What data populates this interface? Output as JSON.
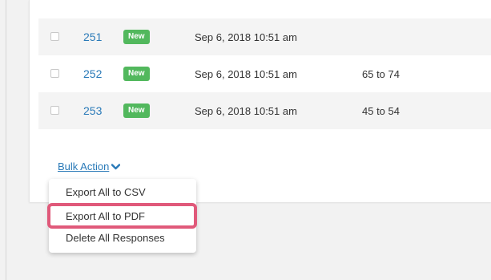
{
  "responses": [
    {
      "id": "251",
      "badge": "New",
      "date": "Sep 6, 2018 10:51 am",
      "age": ""
    },
    {
      "id": "252",
      "badge": "New",
      "date": "Sep 6, 2018 10:51 am",
      "age": "65 to 74"
    },
    {
      "id": "253",
      "badge": "New",
      "date": "Sep 6, 2018 10:51 am",
      "age": "45 to 54"
    }
  ],
  "bulk_action": {
    "label": "Bulk Action",
    "icon": "chevron-down-icon"
  },
  "menu": {
    "items": [
      {
        "label": "Export All to CSV"
      },
      {
        "label": "Export All to PDF",
        "highlighted": true
      },
      {
        "label": "Delete All Responses"
      }
    ]
  },
  "colors": {
    "link": "#2a7ab8",
    "badge": "#52b85d",
    "highlight": "#e0597a"
  }
}
